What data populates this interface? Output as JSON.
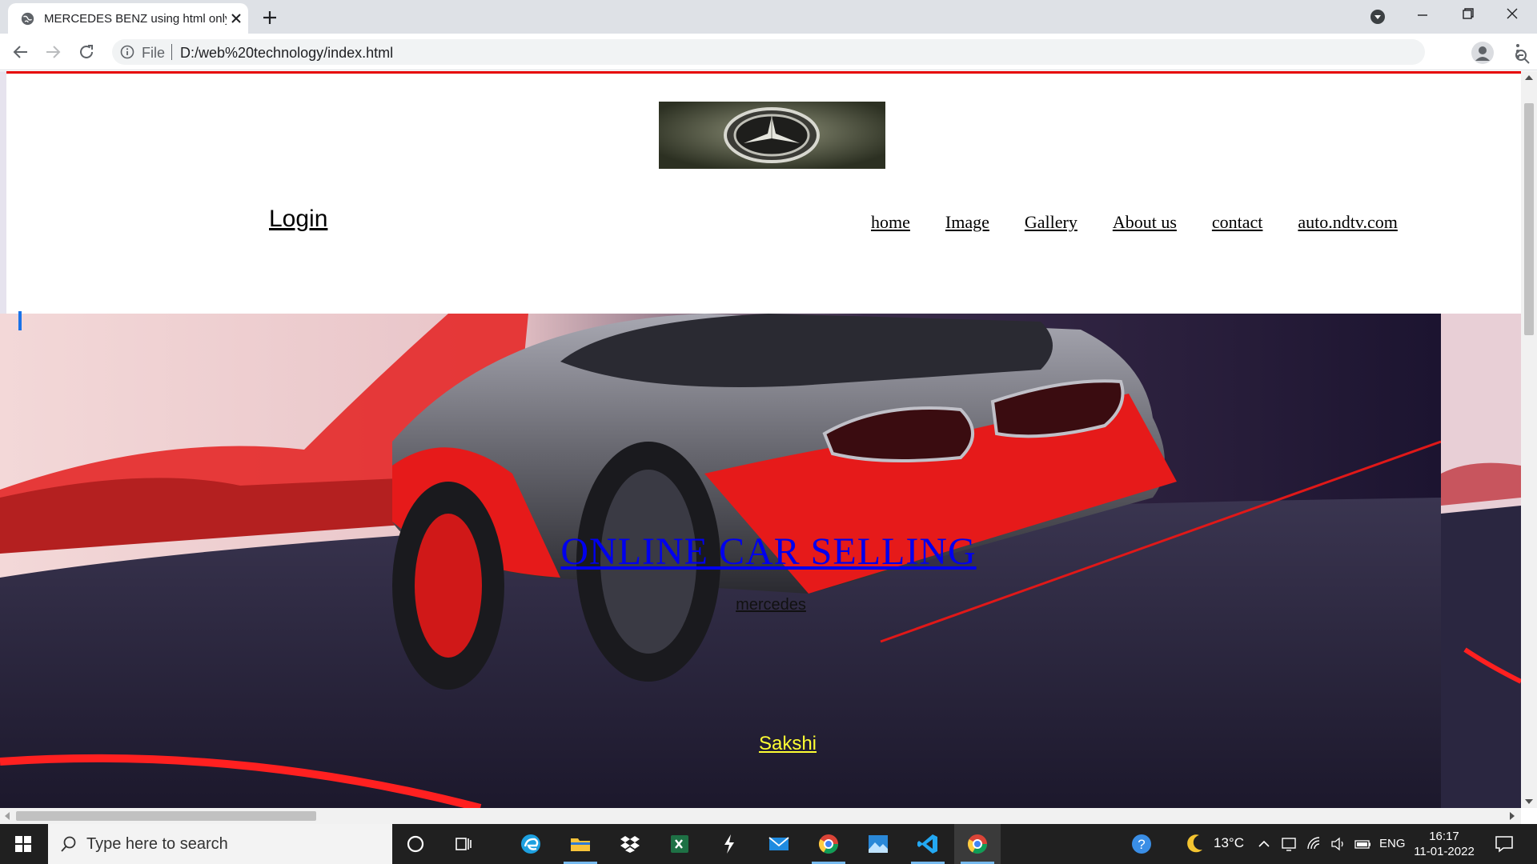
{
  "browser": {
    "tab_title": "MERCEDES BENZ using html only",
    "url_scheme_label": "File",
    "url": "D:/web%20technology/index.html"
  },
  "page": {
    "login": "Login",
    "nav": [
      "home",
      "Image",
      "Gallery",
      "About us",
      "contact",
      "auto.ndtv.com"
    ],
    "hero_title": "ONLINE CAR SELLING",
    "hero_subtitle": "mercedes",
    "hero_name": "Sakshi"
  },
  "taskbar": {
    "search_placeholder": "Type here to search",
    "temperature": "13°C",
    "language": "ENG",
    "time": "16:17",
    "date": "11-01-2022"
  },
  "colors": {
    "accent_red": "#e50000",
    "link_blue": "#0000ee",
    "name_yellow": "#ffff33"
  }
}
